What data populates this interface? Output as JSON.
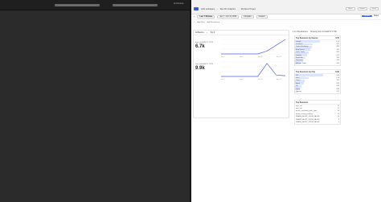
{
  "left_window": {
    "status": "All Windows"
  },
  "browser": {
    "breadcrumbs": [
      "Gill's workspace",
      "Ben W's Analytics",
      "My Demo Project"
    ],
    "top_right": [
      "Share",
      "Export",
      "Save"
    ],
    "toolbar": {
      "pills": [
        "Last 7 Minutes",
        "Jun 7 - Jun 14, 2024",
        "Compare",
        "Custom"
      ],
      "right_buttons": [
        "Update",
        "Reset"
      ]
    },
    "filter_row": [
      "Add Filter",
      "Add Breakdown"
    ]
  },
  "left_panel": {
    "header": [
      "All Metrics",
      "Top 2"
    ],
    "metrics": [
      {
        "label": "Sum of ALERTS TYPE",
        "value": "6.7k"
      },
      {
        "label": "Sum of ALERTS TYPE",
        "value": "9.9k"
      }
    ]
  },
  "right_header": [
    "4 of 4 Breakdowns",
    "Showing Sum of ALERTS TYPE"
  ],
  "tables": [
    {
      "title": "Top Sessions by Source",
      "count": "6.7k",
      "rows": [
        {
          "label": "Google",
          "value": "1.1k",
          "fill": 0.55
        },
        {
          "label": "Facebook",
          "value": "927",
          "fill": 0.4
        },
        {
          "label": "Twitter Marketing",
          "value": "881",
          "fill": 0.38
        },
        {
          "label": "Bing Search",
          "value": "760",
          "fill": 0.34
        },
        {
          "label": "Direct Traffic",
          "value": "681",
          "fill": 0.3
        },
        {
          "label": "Organic",
          "value": "612",
          "fill": 0.27
        },
        {
          "label": "Email Ads",
          "value": "560",
          "fill": 0.24
        },
        {
          "label": "Newsletter",
          "value": "420",
          "fill": 0.18
        },
        {
          "label": "Referral Traffic",
          "value": "290",
          "fill": 0.12
        }
      ]
    },
    {
      "title": "Top Sessions by City",
      "count": "9.9k",
      "rows": [
        {
          "label": "US",
          "value": "4.3k",
          "fill": 0.62
        },
        {
          "label": "India",
          "value": "1.2k",
          "fill": 0.3
        },
        {
          "label": "China",
          "value": "942",
          "fill": 0.22
        },
        {
          "label": "Brazil",
          "value": "812",
          "fill": 0.19
        },
        {
          "label": "UK",
          "value": "603",
          "fill": 0.14
        },
        {
          "label": "Japan",
          "value": "498",
          "fill": 0.11
        },
        {
          "label": "Canada",
          "value": "377",
          "fill": 0.08
        }
      ]
    },
    {
      "title": "Top Sessions",
      "count": "",
      "rows": [
        {
          "label": "item_sid",
          "value": "25",
          "fill": 0
        },
        {
          "label": "item_sid",
          "value": "21",
          "fill": 0
        },
        {
          "label": "admin_confirmed_order_type",
          "value": "19",
          "fill": 0
        },
        {
          "label": "admin_receipt_pending",
          "value": "14",
          "fill": 0
        },
        {
          "label": "SMARK_ALERT_FROM_FAILED",
          "value": "10",
          "fill": 0
        },
        {
          "label": "SMARK_ALERT_FROM_FAILED",
          "value": "8",
          "fill": 0
        },
        {
          "label": "SMARK_ALERT_FROM_FAILED",
          "value": "5",
          "fill": 0
        }
      ]
    }
  ],
  "chart_data": [
    {
      "type": "line",
      "x": [
        "Jun 7",
        "Jun 8",
        "Jun 9",
        "Jun 10",
        "Jun 11",
        "Jun 12",
        "Jun 13",
        "Jun 14"
      ],
      "series": [
        {
          "values": [
            0,
            0,
            0,
            0,
            0,
            0.2,
            0.6,
            1.0
          ]
        }
      ]
    },
    {
      "type": "line",
      "x": [
        "Jun 7",
        "Jun 8",
        "Jun 9",
        "Jun 10",
        "Jun 11",
        "Jun 12",
        "Jun 13",
        "Jun 14"
      ],
      "series": [
        {
          "values": [
            0,
            0,
            0,
            0,
            0,
            0.9,
            0.1,
            0.05
          ]
        }
      ]
    }
  ],
  "colors": {
    "accent": "#3b5bdb",
    "line": "#4b63d8"
  }
}
